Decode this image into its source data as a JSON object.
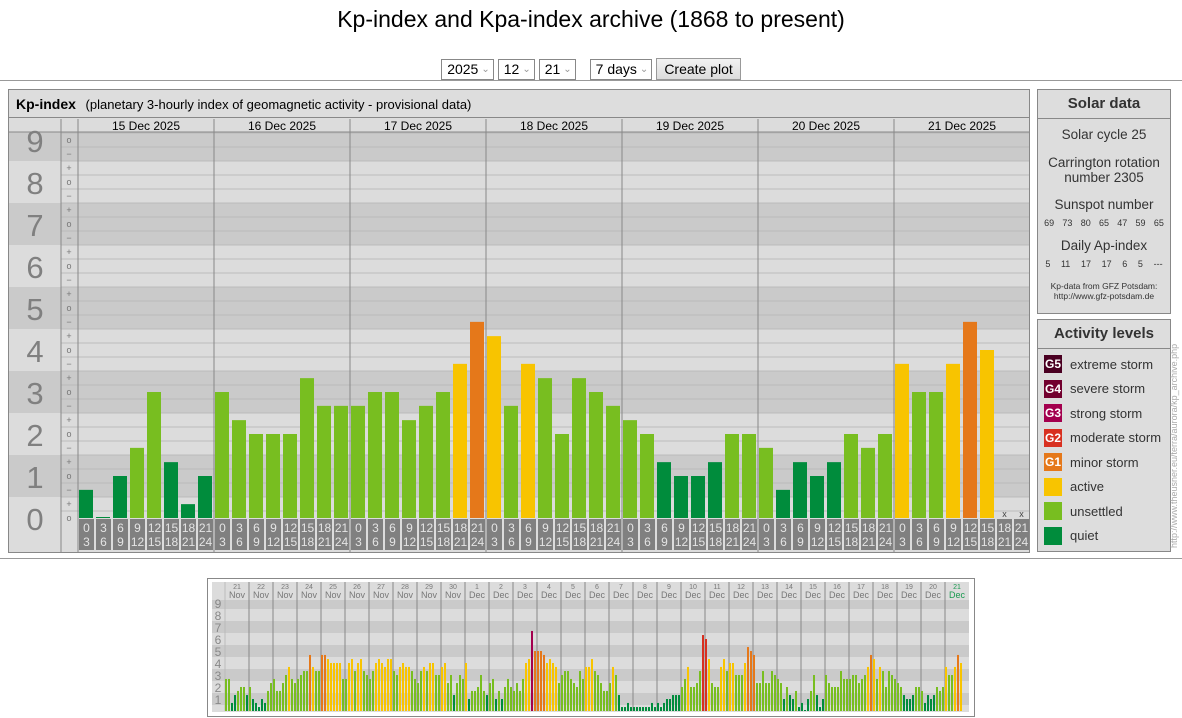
{
  "title": "Kp-index and Kpa-index archive (1868 to present)",
  "controls": {
    "year": "2025",
    "month": "12",
    "day": "21",
    "range": "7 days",
    "create_label": "Create plot"
  },
  "kp_panel": {
    "title": "Kp-index",
    "subtitle": "(planetary 3-hourly index of geomagnetic activity - provisional data)",
    "y_labels": [
      "0",
      "1",
      "2",
      "3",
      "4",
      "5",
      "6",
      "7",
      "8",
      "9"
    ],
    "tick_symbols": {
      "minus": "−",
      "zero": "o",
      "plus": "+"
    },
    "hour_starts": [
      "0",
      "3",
      "6",
      "9",
      "12",
      "15",
      "18",
      "21"
    ],
    "hour_ends": [
      "3",
      "6",
      "9",
      "12",
      "15",
      "18",
      "21",
      "24"
    ],
    "missing_mark": "x"
  },
  "chart_data": [
    {
      "type": "bar",
      "title": "Kp-index",
      "ylim": [
        0,
        9
      ],
      "days": [
        {
          "date": "15 Dec 2025",
          "kp": [
            0.67,
            0,
            1,
            1.67,
            3,
            1.33,
            0.33,
            1
          ]
        },
        {
          "date": "16 Dec 2025",
          "kp": [
            3,
            2.33,
            2,
            2,
            2,
            3.33,
            2.67,
            2.67
          ]
        },
        {
          "date": "17 Dec 2025",
          "kp": [
            2.67,
            3,
            3,
            2.33,
            2.67,
            3,
            3.67,
            4.67
          ]
        },
        {
          "date": "18 Dec 2025",
          "kp": [
            4.33,
            2.67,
            3.67,
            3.33,
            2,
            3.33,
            3,
            2.67
          ]
        },
        {
          "date": "19 Dec 2025",
          "kp": [
            2.33,
            2,
            1.33,
            1,
            1,
            1.33,
            2,
            2
          ]
        },
        {
          "date": "20 Dec 2025",
          "kp": [
            1.67,
            0.67,
            1.33,
            1,
            1.33,
            2,
            1.67,
            2
          ]
        },
        {
          "date": "21 Dec 2025",
          "kp": [
            3.67,
            3,
            3,
            3.67,
            4.67,
            4,
            null,
            null
          ]
        }
      ]
    },
    {
      "type": "bar",
      "ylim": [
        0,
        9
      ],
      "y_ticks": [
        "1",
        "2",
        "3",
        "4",
        "5",
        "6",
        "7",
        "8",
        "9"
      ],
      "days": [
        {
          "day": "21",
          "month": "Nov",
          "kp": [
            2.67,
            2.67,
            0.67,
            1.33,
            1.67,
            2,
            2,
            1.33
          ]
        },
        {
          "day": "22",
          "month": "Nov",
          "kp": [
            2,
            1,
            0.67,
            0.33,
            1,
            0.67,
            1.67,
            2.33
          ]
        },
        {
          "day": "23",
          "month": "Nov",
          "kp": [
            2.67,
            1.67,
            1.67,
            2.33,
            3,
            3.67,
            2.67,
            2.33
          ]
        },
        {
          "day": "24",
          "month": "Nov",
          "kp": [
            2.67,
            3,
            3.33,
            3.33,
            4.67,
            3.67,
            3.33,
            3.33
          ]
        },
        {
          "day": "25",
          "month": "Nov",
          "kp": [
            4.67,
            4.67,
            4.33,
            4,
            4,
            4,
            4,
            2.67
          ]
        },
        {
          "day": "26",
          "month": "Nov",
          "kp": [
            2.67,
            4,
            4.33,
            3.33,
            4,
            4.33,
            3.33,
            3
          ]
        },
        {
          "day": "27",
          "month": "Nov",
          "kp": [
            2.67,
            3.33,
            4,
            4.33,
            4,
            3.67,
            4.33,
            4.33
          ]
        },
        {
          "day": "28",
          "month": "Nov",
          "kp": [
            3.33,
            3,
            3.67,
            4,
            3.67,
            3.67,
            3.33,
            2.67
          ]
        },
        {
          "day": "29",
          "month": "Nov",
          "kp": [
            2.33,
            3.33,
            3.67,
            3.33,
            4,
            4,
            3,
            3
          ]
        },
        {
          "day": "30",
          "month": "Nov",
          "kp": [
            3.67,
            4,
            2.33,
            3,
            1.33,
            2.33,
            3,
            2.67
          ]
        },
        {
          "day": "1",
          "month": "Dec",
          "kp": [
            4,
            1,
            1.67,
            1.67,
            2,
            3,
            1.67,
            1.33
          ]
        },
        {
          "day": "2",
          "month": "Dec",
          "kp": [
            2.33,
            2.67,
            1,
            1.67,
            1,
            2,
            2.67,
            2
          ]
        },
        {
          "day": "3",
          "month": "Dec",
          "kp": [
            1.67,
            2.33,
            1.67,
            2.67,
            4,
            4.33,
            6.67,
            5
          ]
        },
        {
          "day": "4",
          "month": "Dec",
          "kp": [
            5,
            5,
            4.67,
            4,
            4.33,
            4,
            3.67,
            2.33
          ]
        },
        {
          "day": "5",
          "month": "Dec",
          "kp": [
            3,
            3.33,
            3.33,
            2.67,
            2.33,
            2,
            3.33,
            2.67
          ]
        },
        {
          "day": "6",
          "month": "Dec",
          "kp": [
            3.67,
            3.67,
            4.33,
            3.33,
            3,
            2.33,
            1.67,
            1.67
          ]
        },
        {
          "day": "7",
          "month": "Dec",
          "kp": [
            2.33,
            3.67,
            3,
            1.33,
            0.33,
            0.33,
            0.67,
            0.33
          ]
        },
        {
          "day": "8",
          "month": "Dec",
          "kp": [
            0.33,
            0.33,
            0.33,
            0.33,
            0.33,
            0.33,
            0.67,
            0.33
          ]
        },
        {
          "day": "9",
          "month": "Dec",
          "kp": [
            0.67,
            0.33,
            0.67,
            1,
            1,
            1.33,
            1.33,
            1.33
          ]
        },
        {
          "day": "10",
          "month": "Dec",
          "kp": [
            2,
            2.67,
            3.67,
            2,
            2,
            2.33,
            3.33,
            6.33
          ]
        },
        {
          "day": "11",
          "month": "Dec",
          "kp": [
            6,
            4.33,
            2.33,
            2,
            2,
            3.67,
            4.33,
            3.33
          ]
        },
        {
          "day": "12",
          "month": "Dec",
          "kp": [
            4,
            4,
            3,
            3,
            3,
            4,
            5.33,
            5
          ]
        },
        {
          "day": "13",
          "month": "Dec",
          "kp": [
            4.67,
            2.33,
            2.33,
            3.33,
            2.33,
            2.33,
            3.33,
            3
          ]
        },
        {
          "day": "14",
          "month": "Dec",
          "kp": [
            2.67,
            2.33,
            1,
            2,
            1.33,
            1,
            1.67,
            0.33
          ]
        },
        {
          "day": "15",
          "month": "Dec",
          "kp": [
            0.67,
            0,
            1,
            1.67,
            3,
            1.33,
            0.33,
            1
          ]
        },
        {
          "day": "16",
          "month": "Dec",
          "kp": [
            3,
            2.33,
            2,
            2,
            2,
            3.33,
            2.67,
            2.67
          ]
        },
        {
          "day": "17",
          "month": "Dec",
          "kp": [
            2.67,
            3,
            3,
            2.33,
            2.67,
            3,
            3.67,
            4.67
          ]
        },
        {
          "day": "18",
          "month": "Dec",
          "kp": [
            4.33,
            2.67,
            3.67,
            3.33,
            2,
            3.33,
            3,
            2.67
          ]
        },
        {
          "day": "19",
          "month": "Dec",
          "kp": [
            2.33,
            2,
            1.33,
            1,
            1,
            1.33,
            2,
            2
          ]
        },
        {
          "day": "20",
          "month": "Dec",
          "kp": [
            1.67,
            0.67,
            1.33,
            1,
            1.33,
            2,
            1.67,
            2
          ]
        },
        {
          "day": "21",
          "month": "Dec",
          "kp": [
            3.67,
            3,
            3,
            3.67,
            4.67,
            4,
            null,
            null
          ],
          "current": true
        }
      ]
    }
  ],
  "solar": {
    "title": "Solar data",
    "cycle": "Solar cycle 25",
    "carrington": "Carrington rotation number 2305",
    "sunspot_label": "Sunspot number",
    "sunspots": [
      "69",
      "73",
      "80",
      "65",
      "47",
      "59",
      "65"
    ],
    "ap_label": "Daily Ap-index",
    "ap": [
      "5",
      "11",
      "17",
      "17",
      "6",
      "5",
      "---"
    ],
    "source_line1": "Kp-data from GFZ Potsdam:",
    "source_line2": "http://www.gfz-potsdam.de"
  },
  "activity": {
    "title": "Activity levels",
    "levels": [
      {
        "code": "G5",
        "label": "extreme storm",
        "color": "#4a0022"
      },
      {
        "code": "G4",
        "label": "severe storm",
        "color": "#72002e"
      },
      {
        "code": "G3",
        "label": "strong storm",
        "color": "#a3004e"
      },
      {
        "code": "G2",
        "label": "moderate storm",
        "color": "#d83020"
      },
      {
        "code": "G1",
        "label": "minor storm",
        "color": "#e5781a"
      },
      {
        "code": "",
        "label": "active",
        "color": "#f8c400"
      },
      {
        "code": "",
        "label": "unsettled",
        "color": "#78be20"
      },
      {
        "code": "",
        "label": "quiet",
        "color": "#008c3c"
      }
    ]
  },
  "colors": {
    "band_dark": "#cacaca",
    "band_light": "#dcdcdc",
    "grid": "#bbbbbb",
    "divider": "#888888",
    "hour_box": "#808080",
    "current_day": "#1a9a50"
  },
  "watermark_url": "http://www.theusner.eu/terra/aurora/kp_archive.php"
}
